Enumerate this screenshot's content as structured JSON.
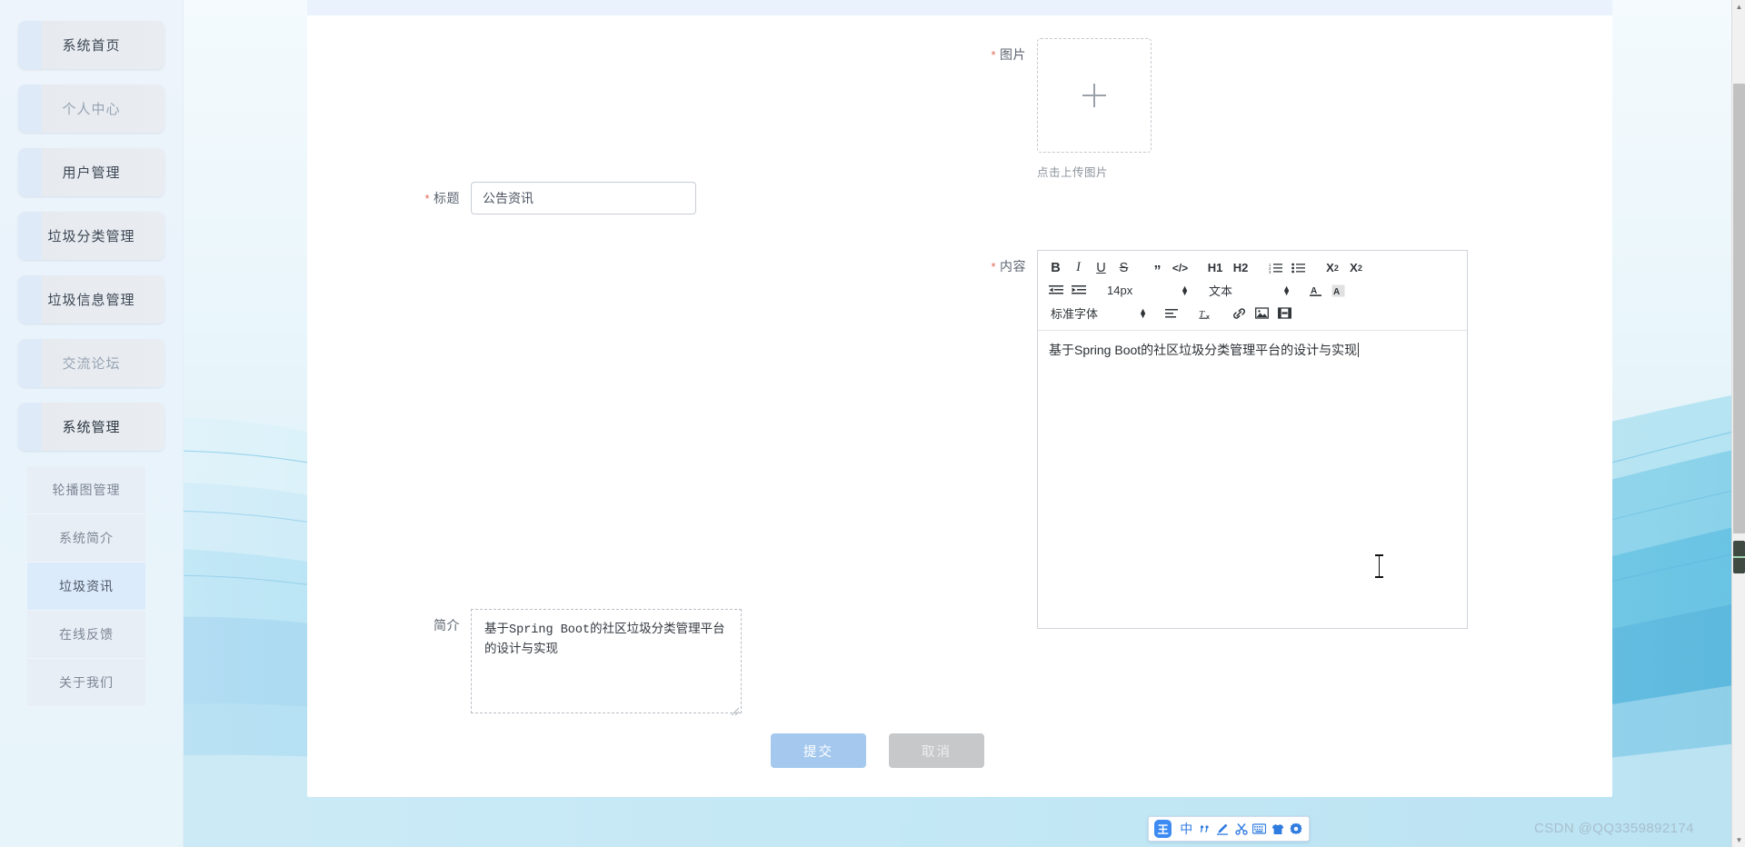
{
  "sidebar": {
    "items": [
      {
        "label": "系统首页",
        "name": "sidebar-item-home",
        "state": "dark"
      },
      {
        "label": "个人中心",
        "name": "sidebar-item-profile",
        "state": "faded"
      },
      {
        "label": "用户管理",
        "name": "sidebar-item-user-manage",
        "state": "dark"
      },
      {
        "label": "垃圾分类管理",
        "name": "sidebar-item-garbage-category",
        "state": "dark"
      },
      {
        "label": "垃圾信息管理",
        "name": "sidebar-item-garbage-info",
        "state": "dark"
      },
      {
        "label": "交流论坛",
        "name": "sidebar-item-forum",
        "state": "faded"
      },
      {
        "label": "系统管理",
        "name": "sidebar-item-system-manage",
        "state": "active"
      }
    ],
    "submenu": [
      {
        "label": "轮播图管理",
        "name": "submenu-item-carousel",
        "selected": false
      },
      {
        "label": "系统简介",
        "name": "submenu-item-system-intro",
        "selected": false
      },
      {
        "label": "垃圾资讯",
        "name": "submenu-item-garbage-news",
        "selected": true
      },
      {
        "label": "在线反馈",
        "name": "submenu-item-feedback",
        "selected": false
      },
      {
        "label": "关于我们",
        "name": "submenu-item-about-us",
        "selected": false
      }
    ]
  },
  "form": {
    "title_field": {
      "label": "标题",
      "required_marker": "*",
      "value": "公告资讯"
    },
    "image_field": {
      "label": "图片",
      "required_marker": "*",
      "upload_hint": "点击上传图片",
      "plus_icon": "plus-icon"
    },
    "content_field": {
      "label": "内容",
      "required_marker": "*",
      "body_text": "基于Spring Boot的社区垃圾分类管理平台的设计与实现",
      "toolbar": {
        "row1": [
          {
            "label": "B",
            "name": "bold-icon"
          },
          {
            "label": "I",
            "name": "italic-icon"
          },
          {
            "label": "U",
            "name": "underline-icon"
          },
          {
            "label": "S",
            "name": "strikethrough-icon"
          },
          {
            "label": "”",
            "name": "blockquote-icon"
          },
          {
            "label": "</>",
            "name": "code-block-icon"
          },
          {
            "label": "H1",
            "name": "heading-1-icon"
          },
          {
            "label": "H2",
            "name": "heading-2-icon"
          },
          {
            "label": "1.",
            "name": "ordered-list-icon"
          },
          {
            "label": "≡",
            "name": "bullet-list-icon"
          },
          {
            "label": "X2",
            "name": "subscript-icon"
          },
          {
            "label": "X2",
            "name": "superscript-icon"
          }
        ],
        "row2": {
          "outdent": "outdent-icon",
          "indent": "indent-icon",
          "font_size_value": "14px",
          "text_style_value": "文本",
          "font_color": "font-color-icon",
          "background_color": "background-color-icon"
        },
        "row3": {
          "font_family_value": "标准字体",
          "align": "align-left-icon",
          "clear_format": "clear-format-icon",
          "link": "link-icon",
          "image": "insert-image-icon",
          "video": "insert-video-icon"
        }
      }
    },
    "brief_field": {
      "label": "简介",
      "value": "基于Spring Boot的社区垃圾分类管理平台的设计与实现"
    },
    "submit_button": "提交",
    "cancel_button": "取消"
  },
  "ime_bar": {
    "logo": "王",
    "icons": [
      {
        "label": "中",
        "name": "ime-chinese-mode-icon"
      },
      {
        "label": "‚‚",
        "name": "ime-punctuation-icon"
      },
      {
        "label": "pen",
        "name": "ime-handwriting-icon"
      },
      {
        "label": "scissors",
        "name": "ime-screenshot-icon"
      },
      {
        "label": "keyboard",
        "name": "ime-soft-keyboard-icon"
      },
      {
        "label": "shirt",
        "name": "ime-skin-icon"
      },
      {
        "label": "gear",
        "name": "ime-settings-icon"
      }
    ]
  },
  "watermark": "CSDN @QQ3359892174",
  "colors": {
    "accent": "#a5c9ee",
    "sidebar_selected": "#dcebfb",
    "required_star": "#e06a5a",
    "ime_blue": "#3d8bf2"
  }
}
